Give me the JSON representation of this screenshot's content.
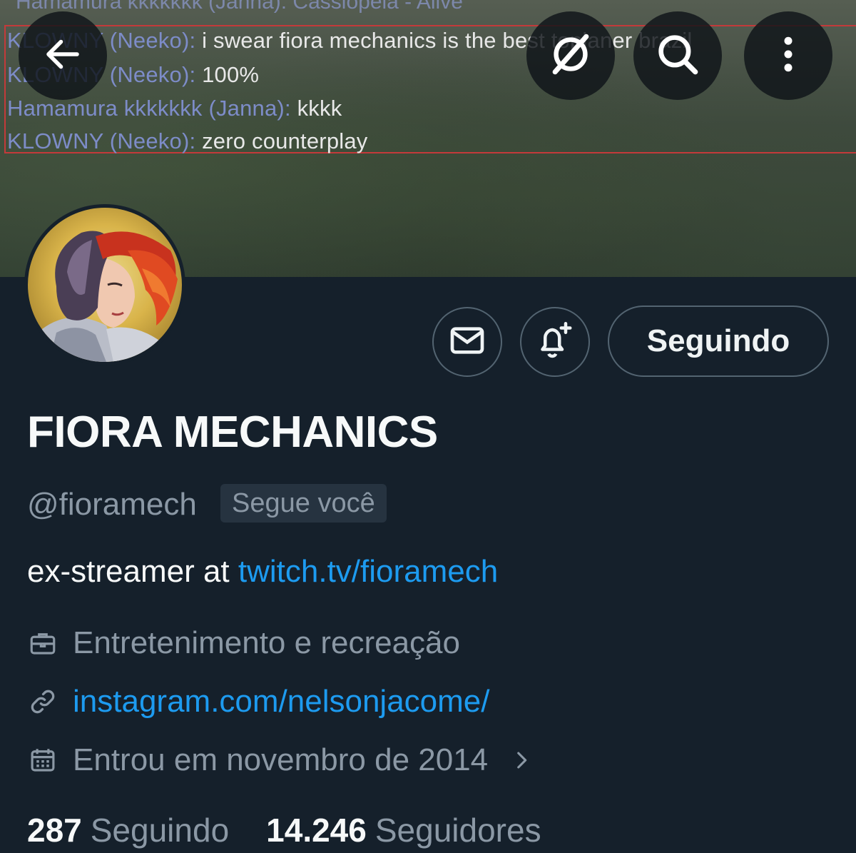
{
  "banner": {
    "chat_top": "Hamamura kkkkkkk (Janna): Cassiopeia - Alive",
    "chat_lines": [
      {
        "name": "KLOWNY (Neeko):",
        "msg": "i swear  fiora mechanics is the best toplaner brazil"
      },
      {
        "name": "KLOWNY (Neeko):",
        "msg": "100%"
      },
      {
        "name": "Hamamura kkkkkkk (Janna):",
        "msg": "kkkk"
      },
      {
        "name": "KLOWNY (Neeko):",
        "msg": "zero counterplay"
      }
    ]
  },
  "top_bar": {
    "back_icon": "arrow-left-icon",
    "grok_icon": "grok-icon",
    "search_icon": "search-icon",
    "more_icon": "more-vertical-icon"
  },
  "actions": {
    "message_icon": "envelope-icon",
    "notify_icon": "bell-plus-icon",
    "follow_label": "Seguindo"
  },
  "profile": {
    "display_name": "FIORA MECHANICS",
    "handle": "@fioramech",
    "follows_you": "Segue você",
    "bio_text": "ex-streamer at ",
    "bio_link": "twitch.tv/fioramech",
    "category": "Entretenimento e recreação",
    "website": "instagram.com/nelsonjacome/",
    "joined": "Entrou em novembro de 2014"
  },
  "stats": {
    "following_count": "287",
    "following_label": "Seguindo",
    "followers_count": "14.246",
    "followers_label": "Seguidores"
  },
  "colors": {
    "background": "#15202b",
    "link": "#1d9bf0",
    "muted": "#8b98a5",
    "border": "#536471"
  }
}
